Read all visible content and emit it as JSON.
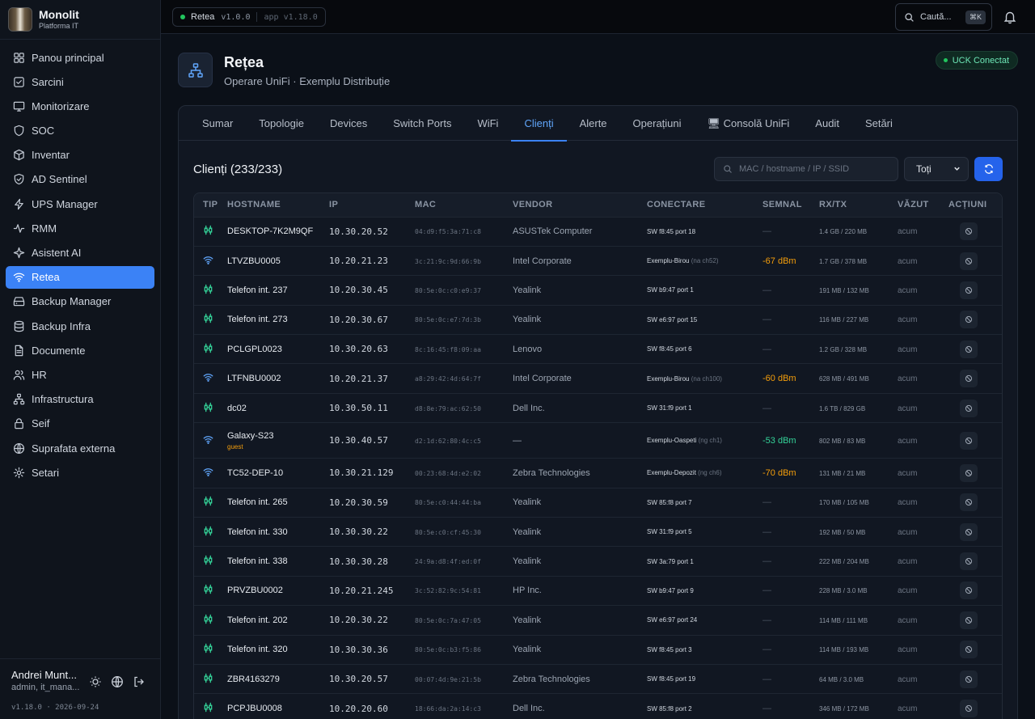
{
  "brand": {
    "name": "Monolit",
    "subtitle": "Platforma IT"
  },
  "nav": [
    {
      "label": "Panou principal",
      "icon": "grid-icon"
    },
    {
      "label": "Sarcini",
      "icon": "checkbox-icon"
    },
    {
      "label": "Monitorizare",
      "icon": "monitor-icon"
    },
    {
      "label": "SOC",
      "icon": "shield-icon"
    },
    {
      "label": "Inventar",
      "icon": "box-icon"
    },
    {
      "label": "AD Sentinel",
      "icon": "shield-check-icon"
    },
    {
      "label": "UPS Manager",
      "icon": "bolt-icon"
    },
    {
      "label": "RMM",
      "icon": "activity-icon"
    },
    {
      "label": "Asistent AI",
      "icon": "sparkle-icon"
    },
    {
      "label": "Retea",
      "icon": "wifi-icon",
      "active": true
    },
    {
      "label": "Backup Manager",
      "icon": "hard-drive-icon"
    },
    {
      "label": "Backup Infra",
      "icon": "database-icon"
    },
    {
      "label": "Documente",
      "icon": "file-icon"
    },
    {
      "label": "HR",
      "icon": "users-icon"
    },
    {
      "label": "Infrastructura",
      "icon": "network-icon"
    },
    {
      "label": "Seif",
      "icon": "lock-icon"
    },
    {
      "label": "Suprafata externa",
      "icon": "globe-icon"
    },
    {
      "label": "Setari",
      "icon": "gear-icon"
    }
  ],
  "user": {
    "name": "Andrei Munt...",
    "role": "admin, it_mana...",
    "version": "v1.18.0 · 2026-09-24"
  },
  "topbar": {
    "app_name": "Retea",
    "module_version": "v1.0.0",
    "app_version": "app v1.18.0",
    "search_label": "Caută...",
    "search_shortcut": "⌘K"
  },
  "header": {
    "title": "Rețea",
    "subtitle": "Operare UniFi · Exemplu Distribuție",
    "status": "UCK Conectat",
    "status_color": "#6ee7b7"
  },
  "tabs": [
    "Sumar",
    "Topologie",
    "Devices",
    "Switch Ports",
    "WiFi",
    "Clienți",
    "Alerte",
    "Operațiuni",
    "🖥 Consolă UniFi",
    "Audit",
    "Setări"
  ],
  "active_tab": "Clienți",
  "clients": {
    "title": "Clienți (233/233)",
    "filter_placeholder": "MAC / hostname / IP / SSID",
    "filter_select": "Toți",
    "columns": [
      "TIP",
      "HOSTNAME",
      "IP",
      "MAC",
      "VENDOR",
      "CONECTARE",
      "SEMNAL",
      "RX/TX",
      "VĂZUT",
      "ACȚIUNI"
    ],
    "rows": [
      {
        "type": "wired",
        "hostname": "DESKTOP-7K2M9QF",
        "ip": "10.30.20.52",
        "mac": "04:d9:f5:3a:71:c8",
        "vendor": "ASUSTek Computer",
        "conn": "SW f8:45 port 18",
        "conn_extra": "",
        "signal": "—",
        "signal_level": "none",
        "rxtx": "1.4 GB / 220 MB",
        "seen": "acum"
      },
      {
        "type": "wifi",
        "hostname": "LTVZBU0005",
        "ip": "10.20.21.23",
        "mac": "3c:21:9c:9d:66:9b",
        "vendor": "Intel Corporate",
        "conn": "Exemplu-Birou",
        "conn_extra": "(na ch52)",
        "signal": "-67 dBm",
        "signal_level": "warn",
        "rxtx": "1.7 GB / 378 MB",
        "seen": "acum"
      },
      {
        "type": "wired",
        "hostname": "Telefon int. 237",
        "ip": "10.20.30.45",
        "mac": "80:5e:0c:c0:e9:37",
        "vendor": "Yealink",
        "conn": "SW b9:47 port 1",
        "conn_extra": "",
        "signal": "—",
        "signal_level": "none",
        "rxtx": "191 MB / 132 MB",
        "seen": "acum"
      },
      {
        "type": "wired",
        "hostname": "Telefon int. 273",
        "ip": "10.20.30.67",
        "mac": "80:5e:0c:e7:7d:3b",
        "vendor": "Yealink",
        "conn": "SW e6:97 port 15",
        "conn_extra": "",
        "signal": "—",
        "signal_level": "none",
        "rxtx": "116 MB / 227 MB",
        "seen": "acum"
      },
      {
        "type": "wired",
        "hostname": "PCLGPL0023",
        "ip": "10.30.20.63",
        "mac": "8c:16:45:f8:09:aa",
        "vendor": "Lenovo",
        "conn": "SW f8:45 port 6",
        "conn_extra": "",
        "signal": "—",
        "signal_level": "none",
        "rxtx": "1.2 GB / 328 MB",
        "seen": "acum"
      },
      {
        "type": "wifi",
        "hostname": "LTFNBU0002",
        "ip": "10.20.21.37",
        "mac": "a8:29:42:4d:64:7f",
        "vendor": "Intel Corporate",
        "conn": "Exemplu-Birou",
        "conn_extra": "(na ch100)",
        "signal": "-60 dBm",
        "signal_level": "warn",
        "rxtx": "628 MB / 491 MB",
        "seen": "acum"
      },
      {
        "type": "wired",
        "hostname": "dc02",
        "ip": "10.30.50.11",
        "mac": "d8:8e:79:ac:62:50",
        "vendor": "Dell Inc.",
        "conn": "SW 31:f9 port 1",
        "conn_extra": "",
        "signal": "—",
        "signal_level": "none",
        "rxtx": "1.6 TB / 829 GB",
        "seen": "acum"
      },
      {
        "type": "wifi",
        "hostname": "Galaxy-S23",
        "tag": "guest",
        "ip": "10.30.40.57",
        "mac": "d2:1d:62:80:4c:c5",
        "vendor": "—",
        "conn": "Exemplu-Oaspeti",
        "conn_extra": "(ng ch1)",
        "signal": "-53 dBm",
        "signal_level": "ok",
        "rxtx": "802 MB / 83 MB",
        "seen": "acum"
      },
      {
        "type": "wifi",
        "hostname": "TC52-DEP-10",
        "ip": "10.30.21.129",
        "mac": "00:23:68:4d:e2:02",
        "vendor": "Zebra Technologies",
        "conn": "Exemplu-Depozit",
        "conn_extra": "(ng ch6)",
        "signal": "-70 dBm",
        "signal_level": "warn",
        "rxtx": "131 MB / 21 MB",
        "seen": "acum"
      },
      {
        "type": "wired",
        "hostname": "Telefon int. 265",
        "ip": "10.20.30.59",
        "mac": "80:5e:c0:44:44:ba",
        "vendor": "Yealink",
        "conn": "SW 85:f8 port 7",
        "conn_extra": "",
        "signal": "—",
        "signal_level": "none",
        "rxtx": "170 MB / 105 MB",
        "seen": "acum"
      },
      {
        "type": "wired",
        "hostname": "Telefon int. 330",
        "ip": "10.30.30.22",
        "mac": "80:5e:c0:cf:45:30",
        "vendor": "Yealink",
        "conn": "SW 31:f9 port 5",
        "conn_extra": "",
        "signal": "—",
        "signal_level": "none",
        "rxtx": "192 MB / 50 MB",
        "seen": "acum"
      },
      {
        "type": "wired",
        "hostname": "Telefon int. 338",
        "ip": "10.30.30.28",
        "mac": "24:9a:d8:4f:ed:0f",
        "vendor": "Yealink",
        "conn": "SW 3a:79 port 1",
        "conn_extra": "",
        "signal": "—",
        "signal_level": "none",
        "rxtx": "222 MB / 204 MB",
        "seen": "acum"
      },
      {
        "type": "wired",
        "hostname": "PRVZBU0002",
        "ip": "10.20.21.245",
        "mac": "3c:52:82:9c:54:81",
        "vendor": "HP Inc.",
        "conn": "SW b9:47 port 9",
        "conn_extra": "",
        "signal": "—",
        "signal_level": "none",
        "rxtx": "228 MB / 3.0 MB",
        "seen": "acum"
      },
      {
        "type": "wired",
        "hostname": "Telefon int. 202",
        "ip": "10.20.30.22",
        "mac": "80:5e:0c:7a:47:05",
        "vendor": "Yealink",
        "conn": "SW e6:97 port 24",
        "conn_extra": "",
        "signal": "—",
        "signal_level": "none",
        "rxtx": "114 MB / 111 MB",
        "seen": "acum"
      },
      {
        "type": "wired",
        "hostname": "Telefon int. 320",
        "ip": "10.30.30.36",
        "mac": "80:5e:0c:b3:f5:86",
        "vendor": "Yealink",
        "conn": "SW f8:45 port 3",
        "conn_extra": "",
        "signal": "—",
        "signal_level": "none",
        "rxtx": "114 MB / 193 MB",
        "seen": "acum"
      },
      {
        "type": "wired",
        "hostname": "ZBR4163279",
        "ip": "10.30.20.57",
        "mac": "00:07:4d:9e:21:5b",
        "vendor": "Zebra Technologies",
        "conn": "SW f8:45 port 19",
        "conn_extra": "",
        "signal": "—",
        "signal_level": "none",
        "rxtx": "64 MB / 3.0 MB",
        "seen": "acum"
      },
      {
        "type": "wired",
        "hostname": "PCPJBU0008",
        "ip": "10.20.20.60",
        "mac": "18:66:da:2a:14:c3",
        "vendor": "Dell Inc.",
        "conn": "SW 85:f8 port 2",
        "conn_extra": "",
        "signal": "—",
        "signal_level": "none",
        "rxtx": "346 MB / 172 MB",
        "seen": "acum"
      }
    ]
  },
  "colors": {
    "accent": "#3b82f6",
    "wired": "#34d399",
    "wifi": "#60a5fa",
    "warn": "#f59e0b",
    "ok": "#34d399"
  }
}
